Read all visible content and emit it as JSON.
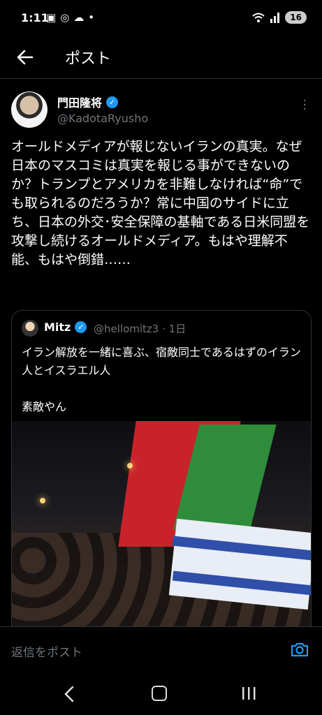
{
  "status": {
    "time": "1:11",
    "battery": "16",
    "left_icons": [
      "sim-icon",
      "messenger-icon",
      "cloud-icon",
      "dot-icon"
    ],
    "right_icons": [
      "wifi-icon",
      "signal-icon"
    ]
  },
  "header": {
    "title": "ポスト"
  },
  "post": {
    "author_name": "門田隆将",
    "handle": "@KadotaRyusho",
    "text": "オールドメディアが報じないイランの真実。なぜ日本のマスコミは真実を報じる事ができないのか？トランプとアメリカを非難しなければ“命”でも取られるのだろうか？常に中国のサイドに立ち、日本の外交･安全保障の基軸である日米同盟を攻撃し続けるオールドメディア。もはや理解不能、もはや倒錯……"
  },
  "quote": {
    "author_name": "Mitz",
    "meta": "@hellomitz3 · 1日",
    "text": "イラン解放を一緒に喜ぶ、宿敵同士であるはずのイラン人とイスラエル人\n\n素敵やん"
  },
  "reply": {
    "placeholder": "返信をポスト"
  },
  "colors": {
    "accent": "#1d9bf0",
    "background": "#000000",
    "muted": "#71767b"
  }
}
